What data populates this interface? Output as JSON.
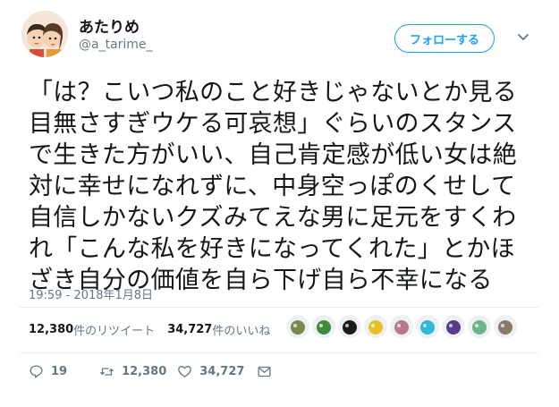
{
  "user": {
    "display_name": "あたりめ",
    "handle": "@a_tarime_"
  },
  "follow_button": {
    "label": "フォローする"
  },
  "tweet": {
    "lines": [
      "「は？こいつ私のこと好きじゃないとか見る",
      "目無さすぎウケる可哀想」ぐらいのスタンス",
      "で生きた方がいい、自己肯定感が低い女は絶",
      "対に幸せになれずに、中身空っぽのくせして",
      "自信しかないクズみてえな男に足元をすくわ",
      "れ「こんな私を好きになってくれた」とかほ",
      "ざき自分の価値を自ら下げ自ら不幸になる"
    ],
    "timestamp": "19:59 - 2018年1月8日"
  },
  "stats": {
    "retweets_count": "12,380",
    "retweets_label": "件のリツイート",
    "likes_count": "34,727",
    "likes_label": "件のいいね"
  },
  "likers": [
    {
      "icon": "avatar-1",
      "color": "#7a8a4a"
    },
    {
      "icon": "avatar-2",
      "color": "#3d8b3d"
    },
    {
      "icon": "avatar-3",
      "color": "#1a1a1a"
    },
    {
      "icon": "avatar-4",
      "color": "#e8c12a"
    },
    {
      "icon": "avatar-5",
      "color": "#b77a8a"
    },
    {
      "icon": "avatar-6",
      "color": "#2fb8d8"
    },
    {
      "icon": "avatar-7",
      "color": "#5a3c8c"
    },
    {
      "icon": "avatar-8",
      "color": "#6fb38a"
    },
    {
      "icon": "avatar-9",
      "color": "#8a7a6a"
    }
  ],
  "actions": {
    "replies": "19",
    "retweets": "12,380",
    "likes": "34,727"
  },
  "colors": {
    "accent": "#1da1f2",
    "muted": "#657786",
    "text": "#14171a"
  }
}
